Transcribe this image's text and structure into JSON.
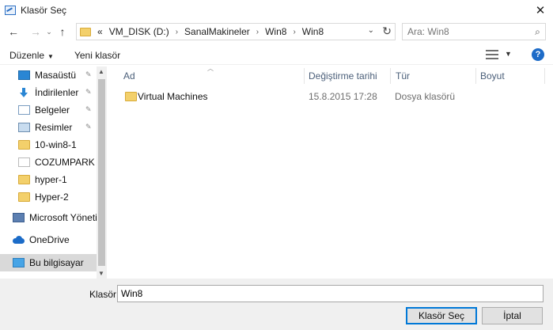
{
  "window": {
    "title": "Klasör Seç"
  },
  "nav": {
    "address_crumbs": [
      "«",
      "VM_DISK (D:)",
      "SanalMakineler",
      "Win8",
      "Win8"
    ],
    "search_placeholder": "Ara: Win8"
  },
  "toolbar": {
    "organize_label": "Düzenle",
    "new_folder_label": "Yeni klasör"
  },
  "sidebar": {
    "items": [
      {
        "label": "Masaüstü",
        "icon": "desktop-icon",
        "pinned": true
      },
      {
        "label": "İndirilenler",
        "icon": "download-icon",
        "pinned": true
      },
      {
        "label": "Belgeler",
        "icon": "documents-icon",
        "pinned": true
      },
      {
        "label": "Resimler",
        "icon": "pictures-icon",
        "pinned": true
      },
      {
        "label": "10-win8-1",
        "icon": "folder-icon",
        "pinned": false
      },
      {
        "label": "COZUMPARK YA",
        "icon": "file-icon",
        "pinned": false
      },
      {
        "label": "hyper-1",
        "icon": "folder-icon",
        "pinned": false
      },
      {
        "label": "Hyper-2",
        "icon": "folder-icon",
        "pinned": false
      },
      {
        "label": "Microsoft Yönetin",
        "icon": "app-icon",
        "pinned": false
      },
      {
        "label": "OneDrive",
        "icon": "cloud-icon",
        "pinned": false
      },
      {
        "label": "Bu bilgisayar",
        "icon": "computer-icon",
        "pinned": false,
        "selected": true
      }
    ]
  },
  "table": {
    "columns": [
      "Ad",
      "Değiştirme tarihi",
      "Tür",
      "Boyut"
    ],
    "rows": [
      {
        "name": "Virtual Machines",
        "modified": "15.8.2015 17:28",
        "type": "Dosya klasörü",
        "size": ""
      }
    ]
  },
  "footer": {
    "folder_label": "Klasör:",
    "folder_value": "Win8",
    "select_button": "Klasör Seç",
    "cancel_button": "İptal"
  },
  "colors": {
    "accent": "#0078d7",
    "help": "#1e6cc8",
    "folder": "#f3d06b"
  }
}
